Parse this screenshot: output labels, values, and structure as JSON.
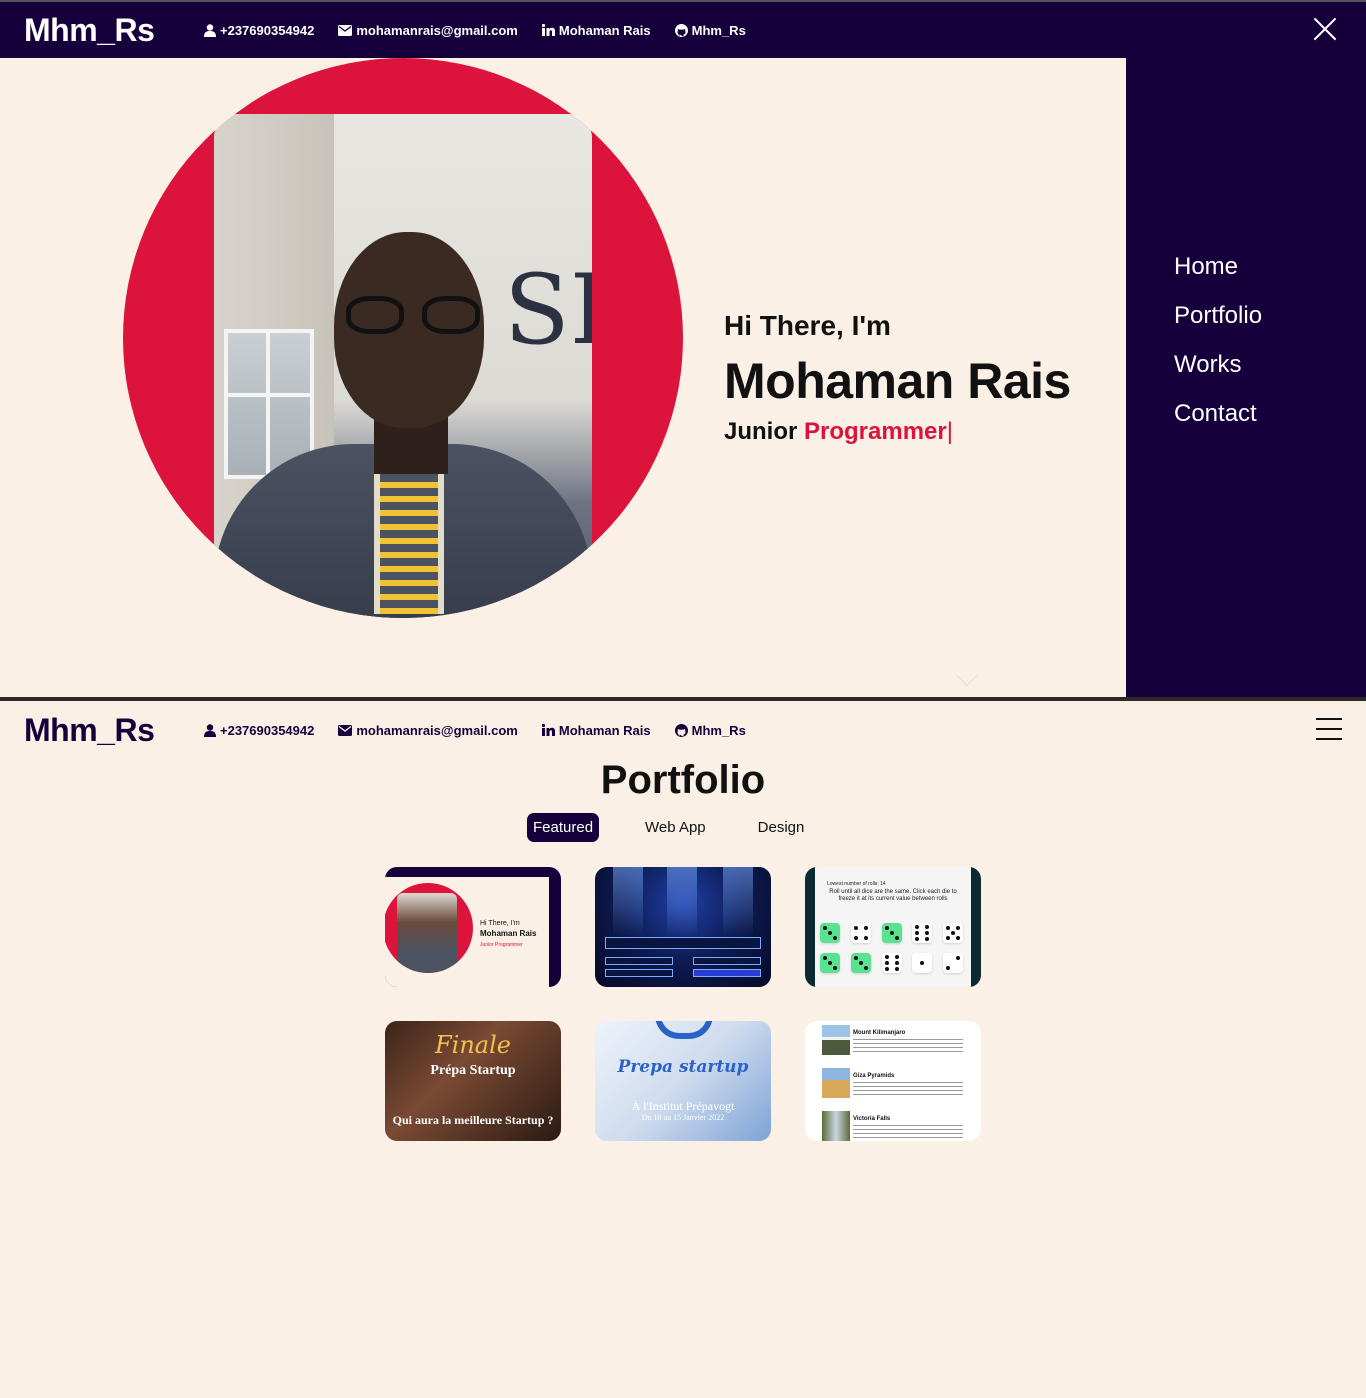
{
  "brand": "Mhm_Rs",
  "contacts": {
    "phone": "+237690354942",
    "email": "mohamanrais@gmail.com",
    "linkedin": "Mohaman Rais",
    "github": "Mhm_Rs"
  },
  "hero": {
    "greeting": "Hi There, I'm",
    "name": "Mohaman Rais",
    "role_prefix": "Junior",
    "role_accent": "Programmer",
    "caret": "|"
  },
  "side_menu": {
    "items": [
      "Home",
      "Portfolio",
      "Works",
      "Contact"
    ]
  },
  "portfolio": {
    "title": "Portfolio",
    "filters": [
      "Featured",
      "Web App",
      "Design"
    ],
    "active_filter": "Featured",
    "cards": {
      "c1": {
        "hi": "Hi There, I'm",
        "name": "Mohaman Rais",
        "role": "Junior Programmer"
      },
      "c3": {
        "rolls": "Lowest number of rolls: 14",
        "instruction": "Roll until all dice are the same. Click each die to freeze it at its current value between rolls"
      },
      "c4": {
        "title": "Finale",
        "subtitle": "Prépa Startup",
        "tagline": "Qui aura la meilleure Startup ?"
      },
      "c5": {
        "title": "Prepa startup",
        "line1": "À l'Institut Prépavogt",
        "line2": "Du 10 au 15 Janvier 2022"
      },
      "c6": {
        "items": [
          "Mount Kilimanjaro",
          "Giza Pyramids",
          "Victoria Falls"
        ]
      }
    }
  },
  "colors": {
    "navy": "#16003b",
    "accent": "#dc143c",
    "cream": "#faf0e6"
  },
  "icons": {
    "phone": "user-icon",
    "email": "envelope-icon",
    "linkedin": "linkedin-icon",
    "github": "github-icon",
    "close": "close-icon",
    "menu": "hamburger-icon"
  }
}
